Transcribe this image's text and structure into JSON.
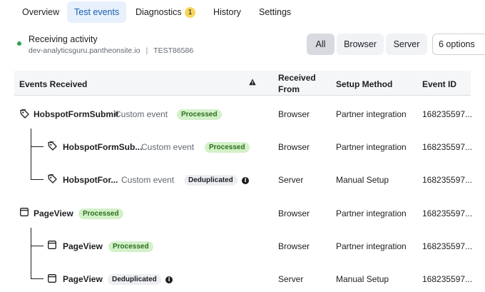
{
  "tabs": [
    {
      "label": "Overview"
    },
    {
      "label": "Test events"
    },
    {
      "label": "Diagnostics",
      "count": "1"
    },
    {
      "label": "History"
    },
    {
      "label": "Settings"
    }
  ],
  "activity": {
    "title": "Receiving activity",
    "domain": "dev-analyticsguru.pantheonsite.io",
    "separator": "|",
    "code": "TEST86586"
  },
  "filters": {
    "all": "All",
    "browser": "Browser",
    "server": "Server",
    "options": "6 options"
  },
  "table": {
    "headers": {
      "events_received": "Events Received",
      "received_from_1": "Received",
      "received_from_2": "From",
      "setup_method": "Setup Method",
      "event_id": "Event ID"
    },
    "rows": [
      {
        "name": "HobspotFormSubmit",
        "type": "Custom event",
        "status": "Processed",
        "from": "Browser",
        "method": "Partner integration",
        "id": "168235597..."
      },
      {
        "name": "HobspotFormSub...",
        "type": "Custom event",
        "status": "Processed",
        "from": "Browser",
        "method": "Partner integration",
        "id": "168235597..."
      },
      {
        "name": "HobspotFor...",
        "type": "Custom event",
        "status": "Deduplicated",
        "from": "Server",
        "method": "Manual Setup",
        "id": "168235597..."
      },
      {
        "name": "PageView",
        "type": "",
        "status": "Processed",
        "from": "Browser",
        "method": "Partner integration",
        "id": "168235597..."
      },
      {
        "name": "PageView",
        "type": "",
        "status": "Processed",
        "from": "Browser",
        "method": "Partner integration",
        "id": "168235597..."
      },
      {
        "name": "PageView",
        "type": "",
        "status": "Deduplicated",
        "from": "Server",
        "method": "Manual Setup",
        "id": "168235597..."
      }
    ]
  },
  "colors": {
    "accent": "#1a5fb4",
    "active_tab_bg": "#e7f0fb",
    "status_green": "#31a24c",
    "processed_bg": "#d3f1c9",
    "diagnostics_badge": "#f7d55a"
  }
}
